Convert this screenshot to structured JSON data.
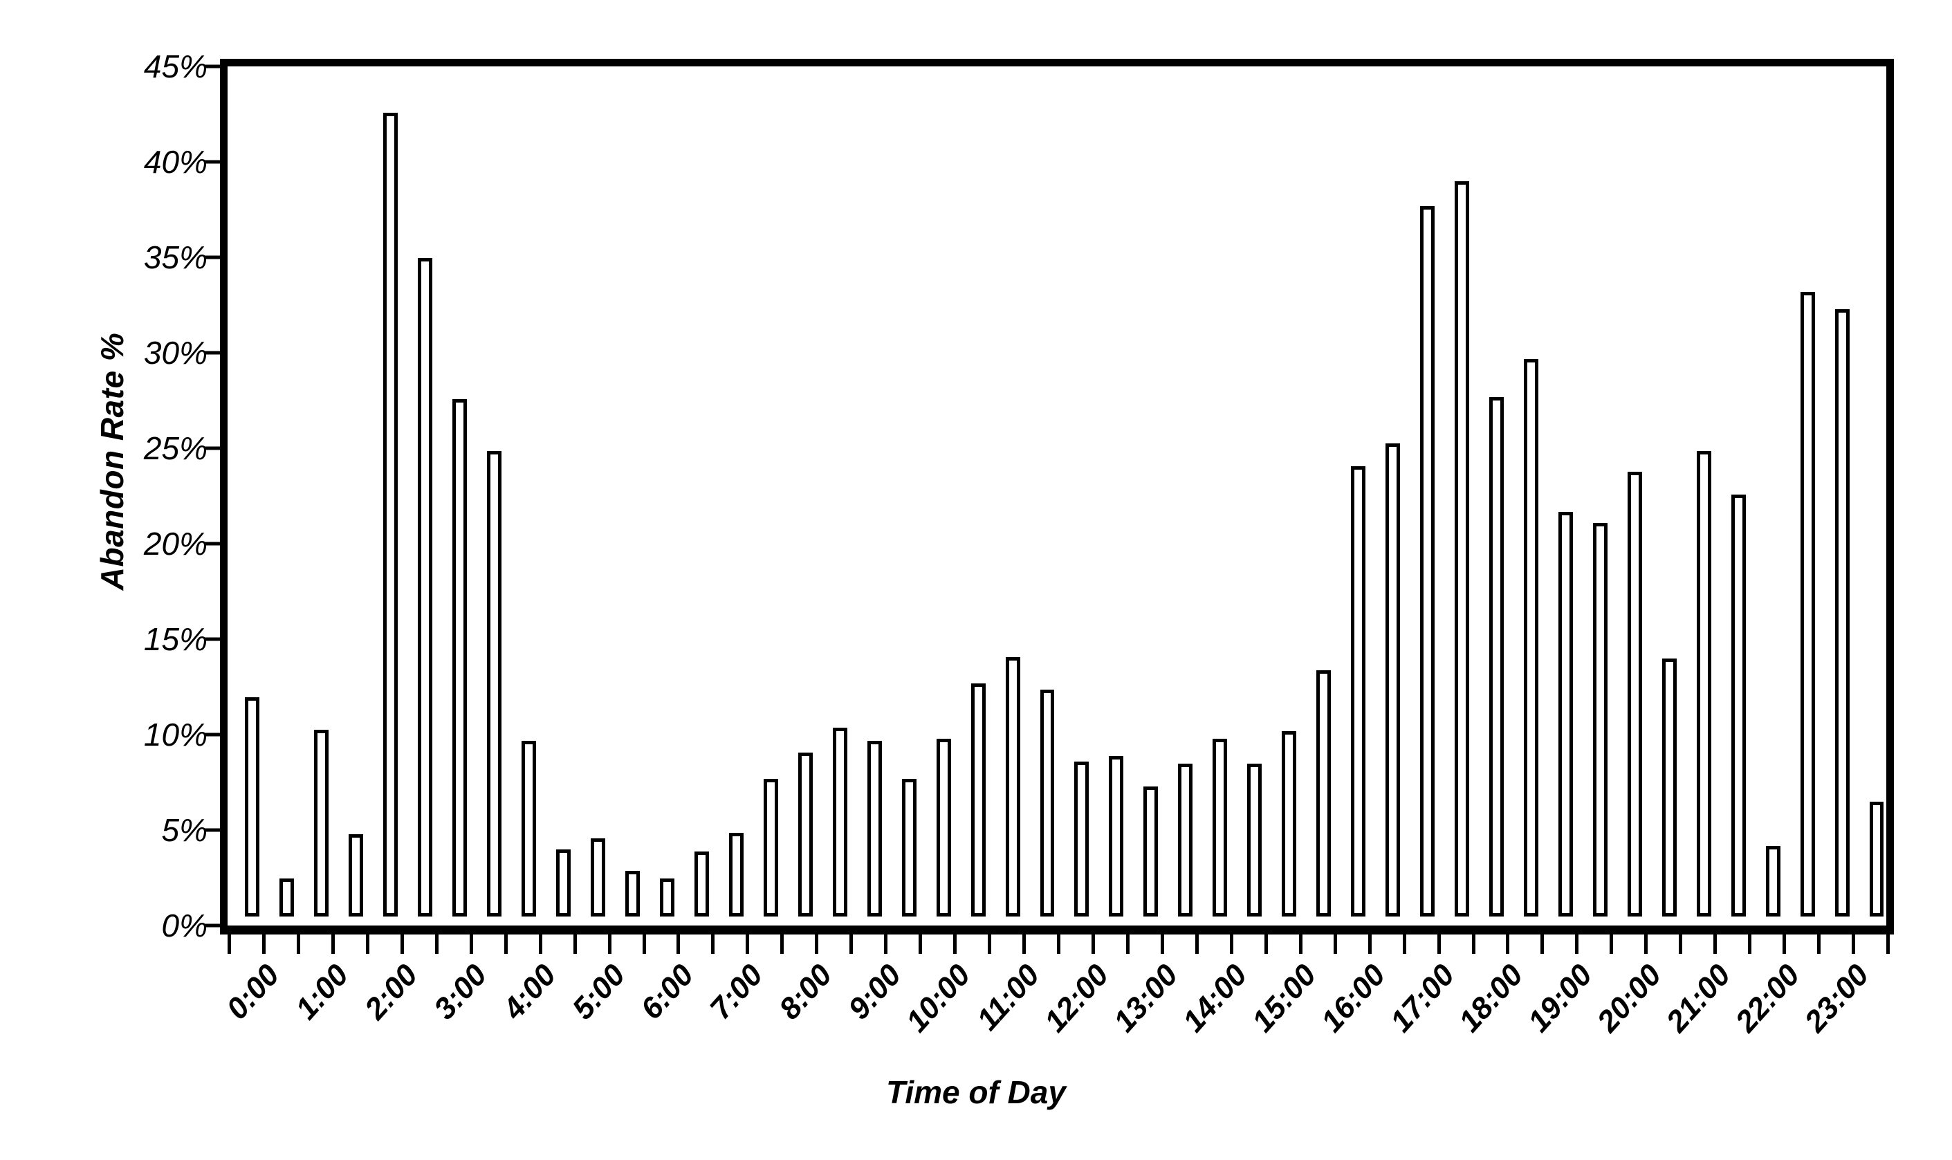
{
  "chart_data": {
    "type": "bar",
    "title": "",
    "xlabel": "Time of Day",
    "ylabel": "Abandon Rate %",
    "ylim": [
      0,
      45
    ],
    "y_tick_step": 5,
    "y_ticks": [
      0,
      5,
      10,
      15,
      20,
      25,
      30,
      35,
      40,
      45
    ],
    "y_tick_labels": [
      "0%",
      "5%",
      "10%",
      "15%",
      "20%",
      "25%",
      "30%",
      "35%",
      "40%",
      "45%"
    ],
    "x_tick_labels": [
      "0:00",
      "1:00",
      "2:00",
      "3:00",
      "4:00",
      "5:00",
      "6:00",
      "7:00",
      "8:00",
      "9:00",
      "10:00",
      "11:00",
      "12:00",
      "13:00",
      "14:00",
      "15:00",
      "16:00",
      "17:00",
      "18:00",
      "19:00",
      "20:00",
      "21:00",
      "22:00",
      "23:00"
    ],
    "grid": false,
    "legend": false,
    "bars_per_hour": 2,
    "bar_fill": "#ffffff",
    "bar_stroke": "#000000",
    "axis_color": "#000000",
    "categories": [
      "0:00",
      "0:30",
      "1:00",
      "1:30",
      "2:00",
      "2:30",
      "3:00",
      "3:30",
      "4:00",
      "4:30",
      "5:00",
      "5:30",
      "6:00",
      "6:30",
      "7:00",
      "7:30",
      "8:00",
      "8:30",
      "9:00",
      "9:30",
      "10:00",
      "10:30",
      "11:00",
      "11:30",
      "12:00",
      "12:30",
      "13:00",
      "13:30",
      "14:00",
      "14:30",
      "15:00",
      "15:30",
      "16:00",
      "16:30",
      "17:00",
      "17:30",
      "18:00",
      "18:30",
      "19:00",
      "19:30",
      "20:00",
      "20:30",
      "21:00",
      "21:30",
      "22:00",
      "22:30",
      "23:00",
      "23:30"
    ],
    "values": [
      11.5,
      2.0,
      9.8,
      4.3,
      42.1,
      34.5,
      27.1,
      24.4,
      9.2,
      3.5,
      4.1,
      2.4,
      2.0,
      3.4,
      4.4,
      7.2,
      8.6,
      9.9,
      9.2,
      7.2,
      9.3,
      12.2,
      13.6,
      11.9,
      8.1,
      8.4,
      6.8,
      8.0,
      9.3,
      8.0,
      9.7,
      12.9,
      23.6,
      24.8,
      37.2,
      38.5,
      27.2,
      29.2,
      21.2,
      20.6,
      23.3,
      13.5,
      24.4,
      22.1,
      3.7,
      32.7,
      31.8,
      6.0
    ]
  }
}
